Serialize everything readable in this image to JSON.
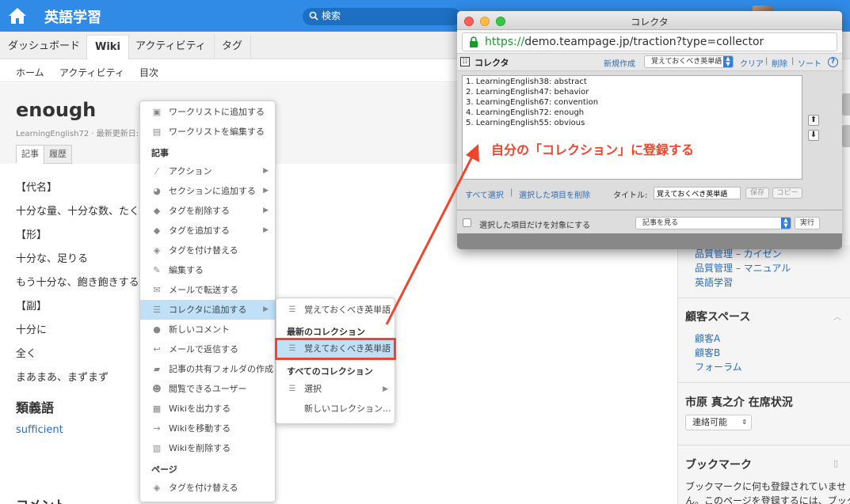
{
  "header": {
    "app_title": "英語学習",
    "search_placeholder": "検索"
  },
  "tabs": [
    "ダッシュボード",
    "Wiki",
    "アクティビティ",
    "タグ"
  ],
  "subnav": [
    "ホーム",
    "アクティビティ",
    "目次"
  ],
  "page": {
    "title": "enough",
    "meta": "LearningEnglish72 · 最新更新日:",
    "tabs": [
      "記事",
      "履歴"
    ],
    "lines": [
      "【代名】",
      "十分な量、十分な数、たく",
      "【形】",
      "十分な、足りる",
      "もう十分な、飽き飽きする",
      "【副】",
      "十分に",
      "全く",
      "まあまあ、まずまず"
    ],
    "synonyms_heading": "類義語",
    "synonym_link": "sufficient",
    "comment_heading": "コメント"
  },
  "context_menu": {
    "items": [
      {
        "icon": "briefcase-icon",
        "label": "ワークリストに追加する",
        "arrow": false
      },
      {
        "icon": "list-edit-icon",
        "label": "ワークリストを編集する",
        "arrow": false
      }
    ],
    "section_article": "記事",
    "article_items": [
      {
        "icon": "wand-icon",
        "label": "アクション",
        "arrow": true
      },
      {
        "icon": "section-icon",
        "label": "セクションに追加する",
        "arrow": true
      },
      {
        "icon": "tag-icon",
        "label": "タグを削除する",
        "arrow": true
      },
      {
        "icon": "tag-icon",
        "label": "タグを追加する",
        "arrow": true
      },
      {
        "icon": "tags-icon",
        "label": "タグを付け替える",
        "arrow": false
      },
      {
        "icon": "pencil-icon",
        "label": "編集する",
        "arrow": false
      },
      {
        "icon": "envelope-icon",
        "label": "メールで転送する",
        "arrow": false
      },
      {
        "icon": "list-icon",
        "label": "コレクタに追加する",
        "arrow": true
      },
      {
        "icon": "comment-icon",
        "label": "新しいコメント",
        "arrow": false
      },
      {
        "icon": "reply-icon",
        "label": "メールで返信する",
        "arrow": false
      },
      {
        "icon": "folder-icon",
        "label": "記事の共有フォルダの作成",
        "arrow": false
      },
      {
        "icon": "users-icon",
        "label": "閲覧できるユーザー",
        "arrow": false
      },
      {
        "icon": "save-icon",
        "label": "Wikiを出力する",
        "arrow": false
      },
      {
        "icon": "arrow-right-icon",
        "label": "Wikiを移動する",
        "arrow": false
      },
      {
        "icon": "trash-icon",
        "label": "Wikiを削除する",
        "arrow": false
      }
    ],
    "section_page": "ページ",
    "page_items": [
      {
        "icon": "tags-icon",
        "label": "タグを付け替える",
        "arrow": false
      }
    ]
  },
  "submenu": {
    "top_item": "覚えておくべき英単語",
    "recent_heading": "最新のコレクション",
    "recent_item": "覚えておくべき英単語",
    "all_heading": "すべてのコレクション",
    "select_label": "選択",
    "new_collection": "新しいコレクション..."
  },
  "collector": {
    "window_title": "コレクタ",
    "url_scheme": "https://",
    "url_rest": "demo.teampage.jp/traction?type=collector",
    "toolbar_title": "コレクタ",
    "new_label": "新規作成",
    "select_value": "覚えておくべき英単語",
    "clear": "クリア",
    "delete": "削除",
    "sort": "ソート",
    "help": "?",
    "list": [
      "1. LearningEnglish38: abstract",
      "2. LearningEnglish47: behavior",
      "3. LearningEnglish67: convention",
      "4. LearningEnglish72: enough",
      "5. LearningEnglish55: obvious"
    ],
    "up": "⬆",
    "down": "⬇",
    "select_all": "すべて選択",
    "remove_selected": "選択した項目を削除",
    "title_label": "タイトル:",
    "title_value": "覚えておくべき英単語",
    "save": "保存",
    "copy": "コピー",
    "only_selected": "選択した項目だけを対象にする",
    "view_select": "記事を見る",
    "run": "実行"
  },
  "annotation": "自分の「コレクション」に登録する",
  "sidebar": {
    "links_top": [
      "品質管理 – カイゼン",
      "品質管理 – マニュアル",
      "英語学習"
    ],
    "customer_heading": "顧客スペース",
    "customer_links": [
      "顧客A",
      "顧客B",
      "フォーラム"
    ],
    "presence_heading": "市原 真之介 在席状況",
    "presence_value": "連絡可能",
    "bookmark_heading": "ブックマーク",
    "bookmark_text_1": "ブックマークに何も登録されていませ",
    "bookmark_text_2": "ん。このページを登録するには、ブック"
  },
  "colors": {
    "topbar": "#2f8be6",
    "link": "#2a6ebb",
    "highlight": "#bfe0f7",
    "annotation": "#f0452d"
  }
}
